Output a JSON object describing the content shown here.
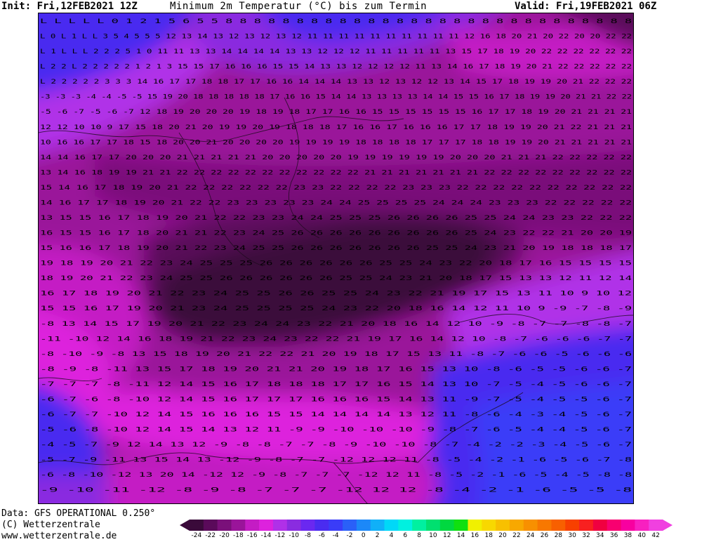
{
  "header": {
    "init_text": "Init: Fri,12FEB2021 12Z",
    "title": "Minimum 2m Temperatur (°C) bis zum Termin",
    "valid_text": "Valid: Fri,19FEB2021 06Z"
  },
  "footer": {
    "data_text": "Data: GFS OPERATIONAL 0.250°",
    "copyright_text": "(C) Wetterzentrale",
    "url_text": "www.wetterzentrale.de"
  },
  "legend": {
    "ticks": [
      "-24",
      "-22",
      "-20",
      "-18",
      "-16",
      "-14",
      "-12",
      "-10",
      "-8",
      "-6",
      "-4",
      "-2",
      "0",
      "2",
      "4",
      "6",
      "8",
      "10",
      "12",
      "14",
      "16",
      "18",
      "20",
      "22",
      "24",
      "26",
      "28",
      "30",
      "32",
      "34",
      "36",
      "38",
      "40",
      "42"
    ],
    "colors": [
      "#3a0a3a",
      "#5a0a5a",
      "#7a107a",
      "#9a149a",
      "#c41cc4",
      "#dd22dd",
      "#b030e8",
      "#8a2ce0",
      "#6a28f0",
      "#4a2cf0",
      "#3a3cf8",
      "#2a60f8",
      "#1c88f8",
      "#10b0f8",
      "#00d8f8",
      "#00f0e0",
      "#00f0a0",
      "#00e070",
      "#00d840",
      "#10e010",
      "#f0f000",
      "#f8d800",
      "#f8c000",
      "#f8a800",
      "#f89000",
      "#f87800",
      "#f86000",
      "#f84000",
      "#f82020",
      "#f00040",
      "#f80070",
      "#f800a0",
      "#f820c0",
      "#f040e0"
    ],
    "cold_arrow_color": "#3a0a3a",
    "warm_arrow_color": "#f040e0"
  },
  "map": {
    "field_colors": {
      "deepest": "#3a0a3a",
      "deep": "#5a0a5a",
      "darkpurple": "#7a107a",
      "purple": "#9a149a",
      "magenta": "#c41cc4",
      "violet": "#b030e8",
      "blueviolet": "#8a2ce0",
      "blue": "#4a2cf0"
    },
    "rows": [
      "L L L L L 0 1 2 1 5 6 5 5 8 8 8 8 8 8 8 8 8 8 8 8 8 8 8 8 8 8 8 8 8 8 8 8 8 8 8 8 8",
      "L 0 L 1 L L 3 5 4 5 5 5 12 13 14 13 12 13 12 13 12 11 11 11 11 11 11 11 11 11 11 12 16 18 20 21 20 22 20 20 22 22",
      "L 1 L L L 2 2 2 5 1 0 11 11 13 13 14 14 14 14 13 13 12 12 12 11 11 11 11 11 13 15 17 18 19 20 22 22 22 22 22 22",
      "L 2 2 L 2 2 2 2 2 1 2 1 3 15 15 17 16 16 16 15 15 14 13 13 12 12 12 12 11 13 14 16 17 18 19 20 21 22 22 22 22 22",
      "L 2 2 2 2 2 3 3 3 14 16 17 17 18 18 17 17 16 16 14 14 14 13 13 12 13 12 12 13 14 15 17 18 19 19 20 21 22 22 22",
      "-3 -3 -3 -4 -4 -5 -5 15 19 20 18 18 18 18 18 17 16 16 15 14 14 13 13 13 13 14 14 15 15 16 17 18 19 19 20 21 21 22 22",
      "-5 -6 -7 -5 -6 -7 12 18 19 20 20 20 19 18 19 18 17 17 16 16 15 15 15 15 15 15 16 17 17 18 19 20 21 21 21 21",
      "12 12 10 10 9 17 15 18 20 21 20 19 19 20 19 18 18 18 17 16 16 17 16 16 16 17 17 18 19 19 20 21 22 21 21 21",
      "10 16 16 17 17 18 15 18 20 20 21 20 20 20 20 19 19 19 19 18 18 18 18 17 17 17 18 18 19 19 20 21 21 21 21 21",
      "14 14 16 17 17 20 20 20 21 21 21 21 21 20 20 20 20 20 19 19 19 19 19 19 20 20 20 21 21 21 22 22 22 22 22",
      "13 14 16 18 19 19 21 21 22 22 22 22 22 22 22 22 22 22 22 21 21 21 21 21 21 21 22 22 22 22 22 22 22 22 22",
      "15 14 16 17 18 19 20 21 22 22 22 22 22 22 23 23 22 22 22 22 23 23 23 22 22 22 22 22 22 22 22 22 22",
      "14 16 17 17 18 19 20 21 22 22 23 23 23 23 23 24 24 25 25 25 25 24 24 24 23 23 23 22 22 22 22 22",
      "13 15 15 16 17 18 19 20 21 22 22 23 23 24 24 25 25 25 26 26 26 26 25 25 24 24 23 23 22 22 22",
      "16 15 15 16 17 18 20 21 21 22 23 24 25 26 26 26 26 26 26 26 26 26 25 24 23 22 22 21 20 20 19",
      "15 16 16 17 18 19 20 21 22 23 24 25 25 26 26 26 26 26 26 26 25 25 24 23 21 20 19 18 18 18 17",
      "19 18 19 20 21 22 23 24 25 25 25 26 26 26 26 26 26 25 25 24 23 22 20 18 17 16 15 15 15 15",
      "18 19 20 21 22 23 24 25 25 26 26 26 26 26 26 25 25 24 23 21 20 18 17 15 13 13 12 11 12 14",
      "16 17 18 19 20 21 22 23 24 25 25 26 26 25 25 24 23 22 21 19 17 15 13 11 10 9 10 12",
      "15 15 16 17 19 20 21 23 24 25 25 25 25 24 23 22 20 18 16 14 12 11 10 9 -9 -7 -8 -9",
      "-8 13 14 15 17 19 20 21 22 23 24 24 23 22 21 20 18 16 14 12 10 -9 -8 -7 -7 -8 -8 -7",
      "-11 -10 12 14 16 18 19 21 22 23 24 23 22 22 21 19 17 16 14 12 10 -8 -7 -6 -6 -6 -7 -7",
      "-8 -10 -9 -8 13 15 18 19 20 21 22 22 21 20 19 18 17 15 13 11 -8 -7 -6 -6 -5 -6 -6 -6",
      "-8 -9 -8 -11 13 15 17 18 19 20 21 21 20 19 18 17 16 15 13 10 -8 -6 -5 -5 -6 -6 -7",
      "-7 -7 -7 -8 -11 12 14 15 16 17 18 18 18 17 17 16 15 14 13 10 -7 -5 -4 -5 -6 -6 -7",
      "-6 -7 -6 -8 -10 12 14 15 16 17 17 17 16 16 16 15 14 13 11 -9 -7 -5 -4 -5 -5 -6 -7",
      "-6 -7 -7 -10 12 14 15 16 16 16 15 15 14 14 14 14 13 12 11 -8 -6 -4 -3 -4 -5 -6 -7",
      "-5 -6 -8 -10 12 14 15 14 13 12 11 -9 -9 -10 -10 -10 -9 -8 -7 -6 -5 -4 -4 -5 -6 -7",
      "-4 -5 -7 -9 12 14 13 12 -9 -8 -8 -7 -7 -8 -9 -10 -10 -8 -7 -4 -2 -2 -3 -4 -5 -6 -7",
      "-5 -7 -9 -11 13 15 14 13 -12 -9 -8 -7 -7 -12 12 12 11 -8 -5 -4 -2 -1 -6 -5 -6 -7 -8",
      "-6 -8 -10 -12 13 20 14 -12 12 -9 -8 -7 -7 -7 -12 12 11 -8 -5 -2 -1 -6 -5 -4 -5 -8 -8",
      "-9 -10 -11 -12 -8 -9 -8 -7 -7 -7 -12 12 12 -8 -4 -2 -1 -6 -5 -5 -8"
    ]
  }
}
